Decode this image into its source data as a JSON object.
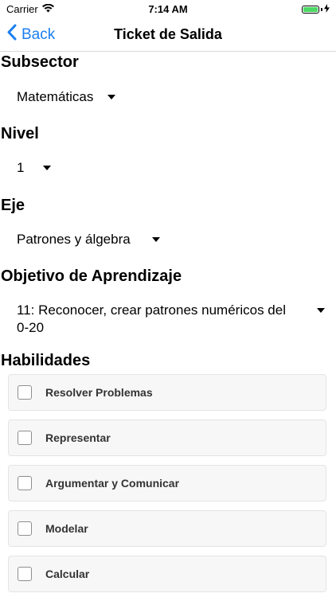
{
  "status_bar": {
    "carrier": "Carrier",
    "time": "7:14 AM",
    "battery_level": 1.0,
    "battery_color": "#4cd964"
  },
  "nav": {
    "back_label": "Back",
    "title": "Ticket de Salida",
    "accent_color": "#1a7ff0"
  },
  "form": {
    "subsector": {
      "label": "Subsector",
      "value": "Matemáticas"
    },
    "nivel": {
      "label": "Nivel",
      "value": "1"
    },
    "eje": {
      "label": "Eje",
      "value": "Patrones y álgebra"
    },
    "objetivo": {
      "label": "Objetivo de Aprendizaje",
      "value": "11: Reconocer, crear patrones numéricos del 0-20"
    },
    "habilidades": {
      "label": "Habilidades",
      "items": [
        {
          "label": "Resolver Problemas",
          "checked": false
        },
        {
          "label": "Representar",
          "checked": false
        },
        {
          "label": "Argumentar y Comunicar",
          "checked": false
        },
        {
          "label": "Modelar",
          "checked": false
        },
        {
          "label": "Calcular",
          "checked": false
        }
      ]
    }
  }
}
